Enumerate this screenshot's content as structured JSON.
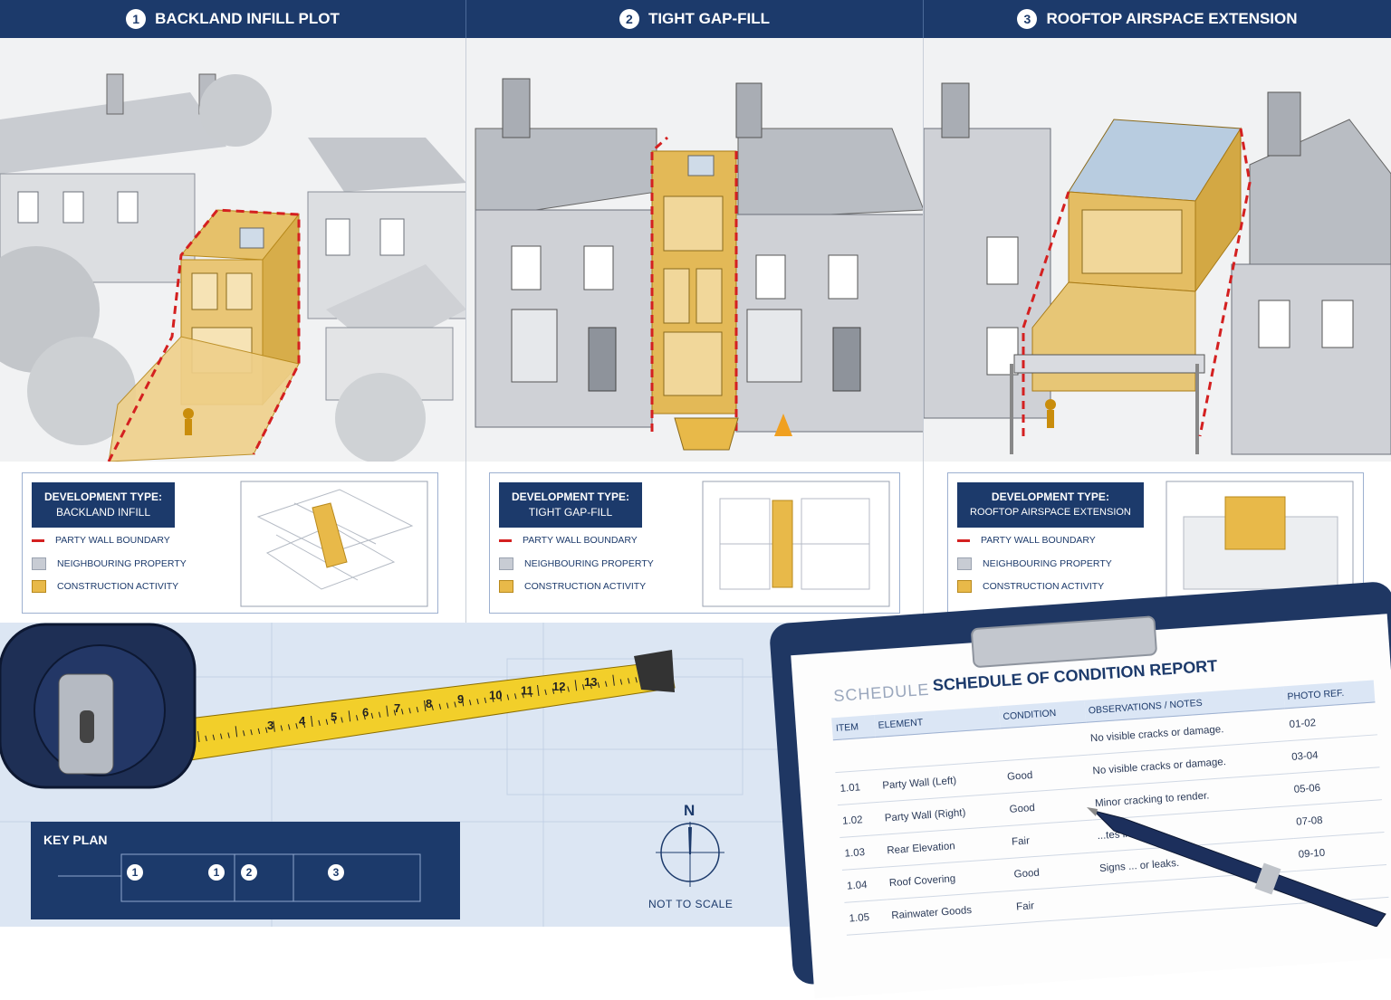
{
  "header": {
    "panels": [
      {
        "number": "1",
        "title": "BACKLAND INFILL PLOT"
      },
      {
        "number": "2",
        "title": "TIGHT GAP-FILL"
      },
      {
        "number": "3",
        "title": "ROOFTOP AIRSPACE EXTENSION"
      }
    ]
  },
  "panels": [
    {
      "dev_label": "DEVELOPMENT TYPE:",
      "dev_type": "BACKLAND INFILL",
      "legend": [
        "PARTY WALL BOUNDARY",
        "NEIGHBOURING PROPERTY",
        "CONSTRUCTION ACTIVITY"
      ]
    },
    {
      "dev_label": "DEVELOPMENT TYPE:",
      "dev_type": "TIGHT GAP-FILL",
      "legend": [
        "PARTY WALL BOUNDARY",
        "NEIGHBOURING PROPERTY",
        "CONSTRUCTION ACTIVITY"
      ]
    },
    {
      "dev_label": "DEVELOPMENT TYPE:",
      "dev_type": "ROOFTOP AIRSPACE EXTENSION",
      "legend": [
        "PARTY WALL BOUNDARY",
        "NEIGHBOURING PROPERTY",
        "CONSTRUCTION ACTIVITY"
      ]
    }
  ],
  "colors": {
    "navy": "#1c3a6b",
    "party_wall_red": "#d42020",
    "neighbouring_grey": "#c8ccd4",
    "construction_yellow": "#e8b949"
  },
  "tape": {
    "numbers": [
      "3",
      "4",
      "5",
      "6",
      "7",
      "8",
      "9",
      "10",
      "11",
      "12",
      "13"
    ]
  },
  "key_plan": {
    "title": "KEY PLAN",
    "markers": [
      "1",
      "2",
      "3"
    ]
  },
  "compass": {
    "north": "N",
    "note": "NOT TO SCALE"
  },
  "report": {
    "title_ghost": "SCHEDULE",
    "title": "SCHEDULE OF CONDITION REPORT",
    "columns": [
      "ITEM",
      "ELEMENT",
      "CONDITION",
      "OBSERVATIONS / NOTES",
      "PHOTO REF."
    ],
    "rows": [
      {
        "item": "",
        "element": "",
        "condition": "",
        "notes": "No visible cracks or damage.",
        "photo": "01-02"
      },
      {
        "item": "1.01",
        "element": "Party Wall (Left)",
        "condition": "Good",
        "notes": "No visible cracks or damage.",
        "photo": "03-04"
      },
      {
        "item": "1.02",
        "element": "Party Wall (Right)",
        "condition": "Good",
        "notes": "Minor cracking to render.",
        "photo": "05-06"
      },
      {
        "item": "1.03",
        "element": "Rear Elevation",
        "condition": "Fair",
        "notes": "...tes intact.",
        "photo": "07-08"
      },
      {
        "item": "1.04",
        "element": "Roof Covering",
        "condition": "Good",
        "notes": "Signs ... or leaks.",
        "photo": "09-10"
      },
      {
        "item": "1.05",
        "element": "Rainwater Goods",
        "condition": "Fair",
        "notes": "",
        "photo": ""
      }
    ]
  }
}
